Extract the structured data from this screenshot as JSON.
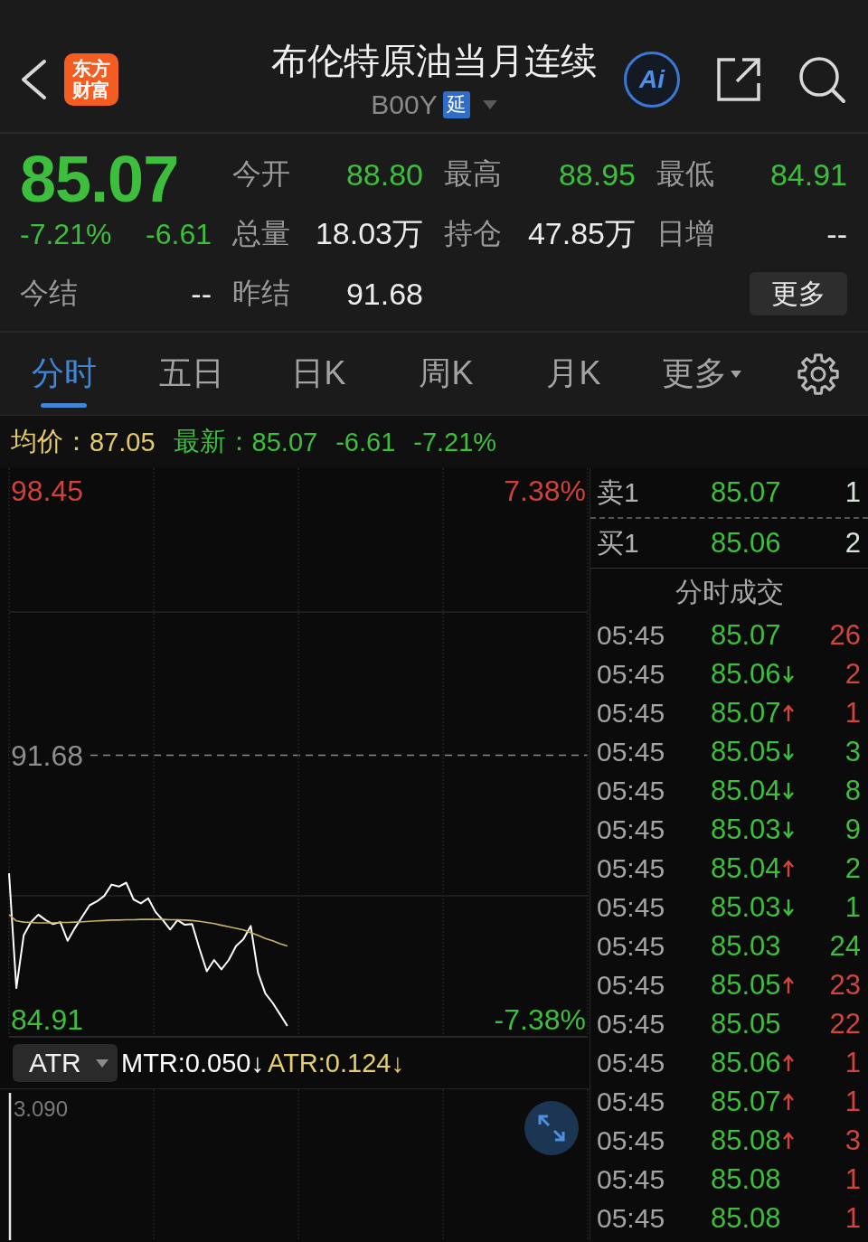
{
  "header": {
    "logo": "东方财富",
    "title": "布伦特原油当月连续",
    "code": "B00Y",
    "badge": "延",
    "ai_label": "Ai"
  },
  "quote": {
    "price": "85.07",
    "change_pct": "-7.21%",
    "change": "-6.61",
    "falling": true,
    "settle_label": "今结",
    "settle_value": "--",
    "stats": [
      {
        "label": "今开",
        "value": "88.80",
        "falling": true
      },
      {
        "label": "最高",
        "value": "88.95",
        "falling": true
      },
      {
        "label": "最低",
        "value": "84.91",
        "falling": true
      },
      {
        "label": "总量",
        "value": "18.03万",
        "falling": false
      },
      {
        "label": "持仓",
        "value": "47.85万",
        "falling": false
      },
      {
        "label": "日增",
        "value": "--",
        "falling": false
      },
      {
        "label": "昨结",
        "value": "91.68",
        "falling": false
      }
    ],
    "more_button": "更多"
  },
  "tabs": [
    {
      "label": "分时",
      "kind": "tab",
      "selected": true
    },
    {
      "label": "五日",
      "kind": "tab",
      "selected": false
    },
    {
      "label": "日K",
      "kind": "tab",
      "selected": false
    },
    {
      "label": "周K",
      "kind": "tab",
      "selected": false
    },
    {
      "label": "月K",
      "kind": "tab",
      "selected": false
    },
    {
      "label": "更多",
      "kind": "menu",
      "selected": false
    }
  ],
  "average_bar": {
    "average_label": "均价：",
    "average_value": "87.05",
    "latest_label": "最新：",
    "latest_value": "85.07",
    "change": "-6.61",
    "change_pct": "-7.21%",
    "falling": true
  },
  "chart": {
    "upper_pct": "7.38%",
    "lower_pct": "-7.38%",
    "chart_data": {
      "type": "line",
      "ylim": [
        84.45,
        99.03
      ],
      "yticks": [
        98.45,
        91.68,
        84.91
      ],
      "series": [
        {
          "color": "#ffffff",
          "values": [
            88.66,
            85.72,
            87.07,
            87.41,
            87.6,
            87.46,
            87.36,
            87.41,
            86.93,
            87.26,
            87.55,
            87.84,
            87.94,
            88.08,
            88.37,
            88.32,
            88.42,
            87.99,
            87.89,
            88.02,
            87.67,
            87.46,
            87.22,
            87.46,
            87.34,
            87.36,
            86.73,
            86.15,
            86.44,
            86.2,
            86.44,
            86.8,
            86.97,
            87.31,
            86.11,
            85.58,
            85.34,
            85.05,
            84.75,
            null,
            null,
            null,
            null,
            null,
            null,
            null,
            null,
            null,
            null,
            null,
            null,
            null,
            null,
            null,
            null,
            null,
            null,
            null,
            null,
            null,
            null,
            null,
            null,
            null,
            null,
            null,
            null,
            null,
            null,
            null,
            null,
            null,
            null,
            null,
            null,
            null,
            null,
            null,
            null,
            null
          ]
        },
        {
          "color": "#c9b46a",
          "values": [
            87.6,
            87.44,
            87.41,
            87.4,
            87.39,
            87.39,
            87.39,
            87.4,
            87.4,
            87.41,
            87.42,
            87.43,
            87.44,
            87.45,
            87.46,
            87.46,
            87.47,
            87.47,
            87.48,
            87.48,
            87.48,
            87.48,
            87.47,
            87.47,
            87.46,
            87.45,
            87.43,
            87.4,
            87.37,
            87.33,
            87.29,
            87.25,
            87.21,
            87.14,
            87.07,
            86.99,
            86.93,
            86.86,
            86.8,
            null,
            null,
            null,
            null,
            null,
            null,
            null,
            null,
            null,
            null,
            null,
            null,
            null,
            null,
            null,
            null,
            null,
            null,
            null,
            null,
            null,
            null,
            null,
            null,
            null,
            null,
            null,
            null,
            null,
            null,
            null,
            null,
            null,
            null,
            null,
            null,
            null,
            null,
            null,
            null,
            null
          ]
        }
      ]
    }
  },
  "order_book": [
    {
      "label": "卖1",
      "price": "85.07",
      "qty": "1",
      "falling": true
    },
    {
      "label": "买1",
      "price": "85.06",
      "qty": "2",
      "falling": true
    }
  ],
  "trades_title": "分时成交",
  "trades": [
    {
      "time": "05:45",
      "price": "85.07",
      "falling": true,
      "kind": "plain",
      "qty": "26",
      "color": "#d2453e"
    },
    {
      "time": "05:45",
      "price": "85.06",
      "falling": true,
      "kind": "downtick",
      "qty": "2",
      "color": "#d2453e"
    },
    {
      "time": "05:45",
      "price": "85.07",
      "falling": true,
      "kind": "uptick",
      "qty": "1",
      "color": "#d2453e"
    },
    {
      "time": "05:45",
      "price": "85.05",
      "falling": true,
      "kind": "downtick",
      "qty": "3",
      "color": "#3dbf3d"
    },
    {
      "time": "05:45",
      "price": "85.04",
      "falling": true,
      "kind": "downtick",
      "qty": "8",
      "color": "#3dbf3d"
    },
    {
      "time": "05:45",
      "price": "85.03",
      "falling": true,
      "kind": "downtick",
      "qty": "9",
      "color": "#3dbf3d"
    },
    {
      "time": "05:45",
      "price": "85.04",
      "falling": true,
      "kind": "uptick",
      "qty": "2",
      "color": "#3dbf3d"
    },
    {
      "time": "05:45",
      "price": "85.03",
      "falling": true,
      "kind": "downtick",
      "qty": "1",
      "color": "#3dbf3d"
    },
    {
      "time": "05:45",
      "price": "85.03",
      "falling": true,
      "kind": "plain",
      "qty": "24",
      "color": "#3dbf3d"
    },
    {
      "time": "05:45",
      "price": "85.05",
      "falling": true,
      "kind": "uptick",
      "qty": "23",
      "color": "#d2453e"
    },
    {
      "time": "05:45",
      "price": "85.05",
      "falling": true,
      "kind": "plain",
      "qty": "22",
      "color": "#d2453e"
    },
    {
      "time": "05:45",
      "price": "85.06",
      "falling": true,
      "kind": "uptick",
      "qty": "1",
      "color": "#d2453e"
    },
    {
      "time": "05:45",
      "price": "85.07",
      "falling": true,
      "kind": "uptick",
      "qty": "1",
      "color": "#d2453e"
    },
    {
      "time": "05:45",
      "price": "85.08",
      "falling": true,
      "kind": "uptick",
      "qty": "3",
      "color": "#d2453e"
    },
    {
      "time": "05:45",
      "price": "85.08",
      "falling": true,
      "kind": "plain",
      "qty": "1",
      "color": "#d2453e"
    },
    {
      "time": "05:45",
      "price": "85.08",
      "falling": true,
      "kind": "plain",
      "qty": "1",
      "color": "#d2453e"
    }
  ],
  "indicator": {
    "selector": "ATR",
    "readings": [
      {
        "text": "MTR:0.050↓",
        "color": "#ffffff"
      },
      {
        "text": "ATR:0.124↓",
        "color": "#e6cf6a"
      }
    ],
    "axis_label": "3.090"
  }
}
